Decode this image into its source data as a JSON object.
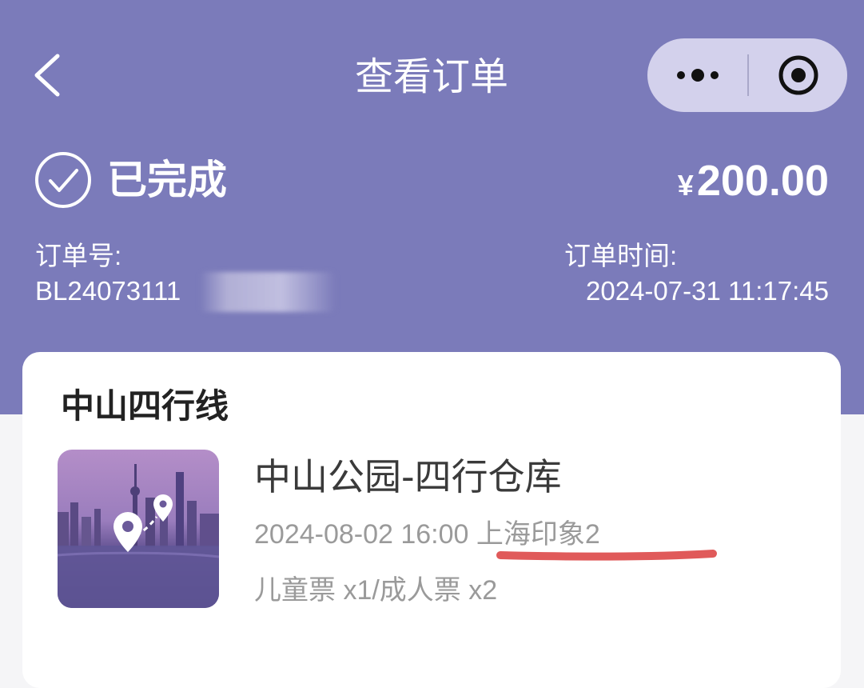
{
  "nav": {
    "title": "查看订单"
  },
  "icons": {
    "back": "chevron-left-icon",
    "more": "more-dots-icon",
    "close": "target-close-icon",
    "status": "check-circle-icon"
  },
  "colors": {
    "header_bg": "#7b7bba",
    "capsule_bg": "#d3d1ec",
    "highlight_mark": "#e05a5a"
  },
  "order": {
    "status": "已完成",
    "currency": "¥",
    "amount": "200.00",
    "order_no_label": "订单号:",
    "order_no": "BL24073111",
    "order_time_label": "订单时间:",
    "order_time": "2024-07-31 11:17:45"
  },
  "card": {
    "route_name": "中山四行线",
    "product_title": "中山公园-四行仓库",
    "product_datetime": "2024-08-02 16:00",
    "product_venue": "上海印象2",
    "tickets": "儿童票 x1/成人票 x2"
  }
}
